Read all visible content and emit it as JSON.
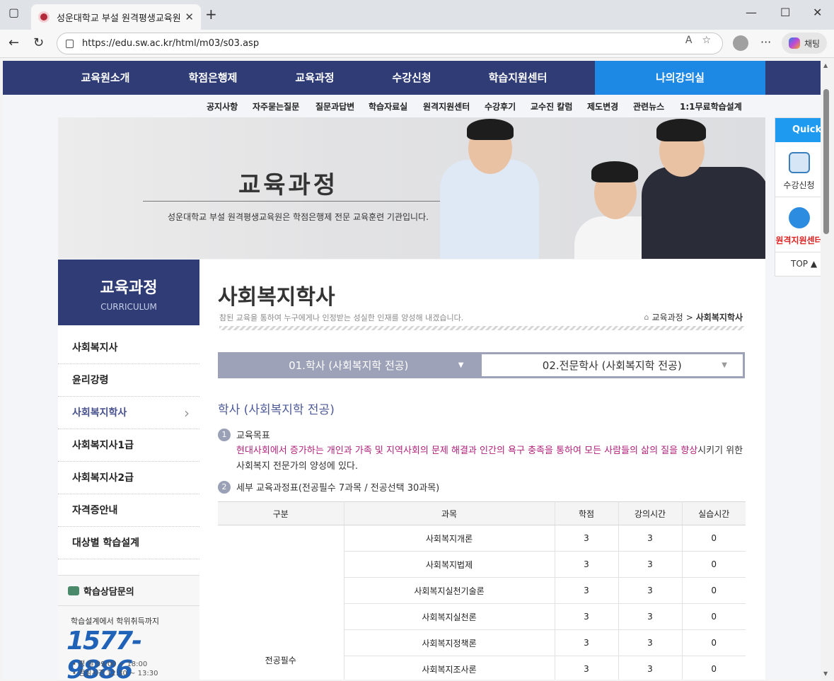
{
  "browser": {
    "tab_title": "성운대학교 부설 원격평생교육원",
    "url": "https://edu.sw.ac.kr/html/m03/s03.asp",
    "chat_label": "채팅"
  },
  "gnb": {
    "items": [
      "교육원소개",
      "학점은행제",
      "교육과정",
      "수강신청",
      "학습지원센터",
      "나의강의실"
    ]
  },
  "subnav": {
    "items": [
      "공지사항",
      "자주묻는질문",
      "질문과답변",
      "학습자료실",
      "원격지원센터",
      "수강후기",
      "교수진 칼럼",
      "제도변경",
      "관련뉴스",
      "1:1무료학습설계"
    ]
  },
  "banner": {
    "title": "교육과정",
    "subtitle": "성운대학교 부설 원격평생교육원은 학점은행제 전문 교육훈련 기관입니다."
  },
  "lnb": {
    "title": "교육과정",
    "subtitle": "CURRICULUM",
    "items": [
      "사회복지사",
      "윤리강령",
      "사회복지학사",
      "사회복지사1급",
      "사회복지사2급",
      "자격증안내",
      "대상별 학습설계"
    ],
    "consult": {
      "title": "학습상담문의",
      "desc": "학습설계에서 학위취득까지",
      "phone": "1577-9886",
      "hours_1": "•  평       일  09:00 ~ 18:00",
      "hours_2": "•  점심시간  12:30 ~ 13:30"
    }
  },
  "main": {
    "title": "사회복지학사",
    "subtitle": "참된 교육을 통하여 누구에게나 인정받는 성실한 인재를 양성해 내겠습니다.",
    "breadcrumb": {
      "parent": "교육과정",
      "sep": ">",
      "current": "사회복지학사"
    },
    "tabs": [
      {
        "label": "01.학사 (사회복지학 전공)"
      },
      {
        "label": "02.전문학사 (사회복지학 전공)"
      }
    ],
    "section_title": "학사 (사회복지학 전공)",
    "goal": {
      "num": "1",
      "heading": "교육목표",
      "text_highlight": "현대사회에서 증가하는 개인과 가족 및 지역사회의 문제 해결과 인간의 욕구 충족을 통하여 모든 사람들의 삶의 질을 향상",
      "text_rest": "시키기 위한 사회복지 전문가의 양성에 있다."
    },
    "curriculum": {
      "num": "2",
      "heading": "세부 교육과정표(전공필수 7과목 / 전공선택 30과목)",
      "columns": [
        "구분",
        "과목",
        "학점",
        "강의시간",
        "실습시간"
      ],
      "group": "전공필수",
      "rows": [
        [
          "사회복지개론",
          "3",
          "3",
          "0"
        ],
        [
          "사회복지법제",
          "3",
          "3",
          "0"
        ],
        [
          "사회복지실천기술론",
          "3",
          "3",
          "0"
        ],
        [
          "사회복지실천론",
          "3",
          "3",
          "0"
        ],
        [
          "사회복지정책론",
          "3",
          "3",
          "0"
        ],
        [
          "사회복지조사론",
          "3",
          "3",
          "0"
        ]
      ]
    }
  },
  "quick": {
    "title": "Quick",
    "items": [
      "수강신청",
      "원격지원센터"
    ],
    "top": "TOP ▲"
  }
}
